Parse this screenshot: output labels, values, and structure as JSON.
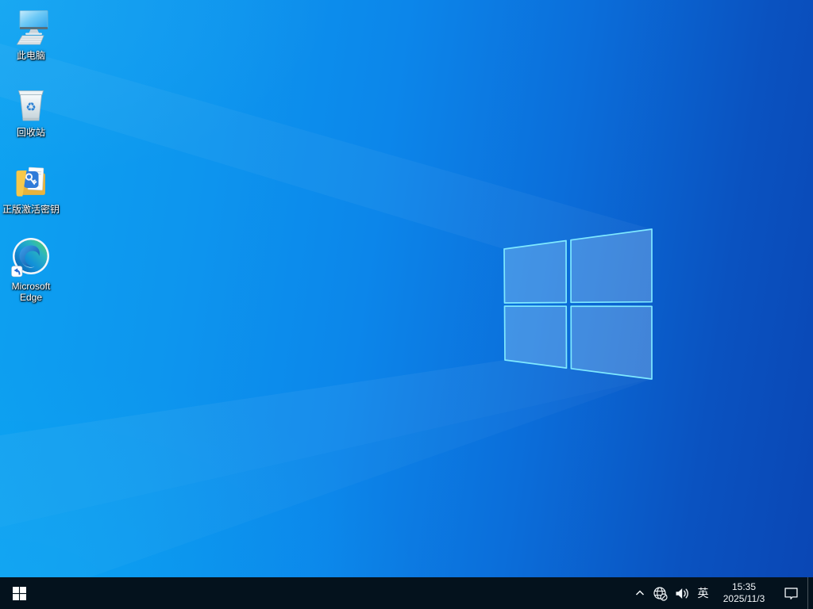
{
  "desktop": {
    "icons": [
      {
        "id": "this-pc",
        "label": "此电脑"
      },
      {
        "id": "recycle-bin",
        "label": "回收站"
      },
      {
        "id": "activation-key-folder",
        "label": "正版激活密钥"
      },
      {
        "id": "microsoft-edge",
        "label": "Microsoft Edge"
      }
    ]
  },
  "taskbar": {
    "start": {
      "icon": "windows-logo"
    },
    "tray": {
      "hidden_icons": "chevron-up-icon",
      "network": "globe-offline-icon",
      "volume": "speaker-icon",
      "ime": "英",
      "time": "15:35",
      "date": "2025/11/3",
      "action_center": "chat-square-icon"
    }
  },
  "colors": {
    "wallpaper_bright": "#0da2f1",
    "wallpaper_deep": "#0a46b4",
    "logo_stroke": "#7fe9ff",
    "taskbar_bg": "#04121d",
    "tray_foreground": "#f2f6f9",
    "label_text": "#ffffff"
  }
}
